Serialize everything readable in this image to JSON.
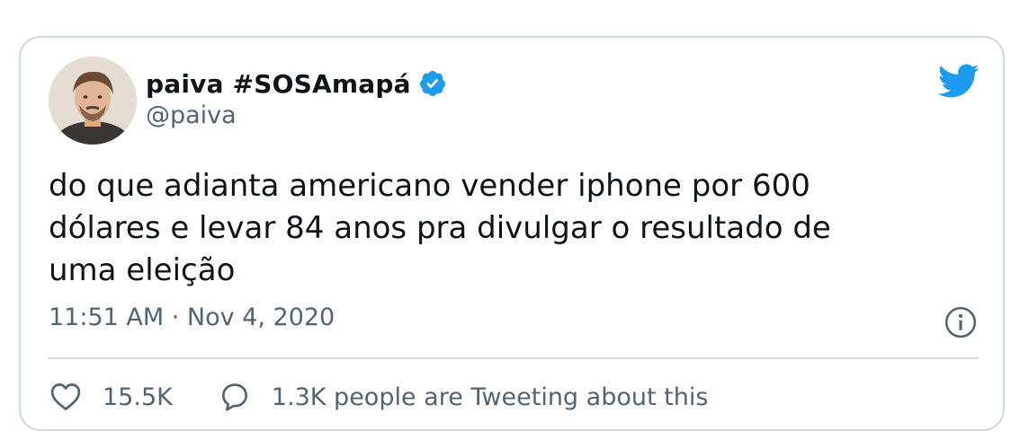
{
  "author": {
    "display_name": "paiva #SOSAmapá",
    "handle": "@paiva",
    "verified": true,
    "avatar_icon": "user-avatar-photo"
  },
  "tweet": {
    "text": "do que adianta americano vender iphone por 600\ndólares e levar 84 anos pra divulgar o resultado de\numa eleição",
    "timestamp": "11:51 AM · Nov 4, 2020"
  },
  "actions": {
    "likes": "15.5K",
    "conversation": "1.3K people are Tweeting about this"
  },
  "icons": {
    "brand": "twitter-bird-icon",
    "verified": "verified-badge-icon",
    "info": "info-icon",
    "like": "heart-icon",
    "reply": "reply-bubble-icon"
  },
  "colors": {
    "brand": "#1d9bf0",
    "text": "#0f1419",
    "secondary": "#536471",
    "border": "#cfd9de"
  }
}
